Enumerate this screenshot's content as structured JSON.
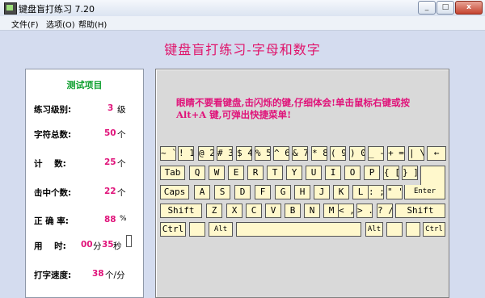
{
  "window": {
    "title": "键盘盲打练习 7.20",
    "minimize_label": "_",
    "maximize_label": "□",
    "close_label": "x"
  },
  "menu": [
    "文件(F)",
    "选项(O)",
    "帮助(H)"
  ],
  "main_title": "键盘盲打练习-字母和数字",
  "stats": {
    "title": "测试项目",
    "level_label": "练习级别:",
    "level_value": "3",
    "level_unit": "级",
    "total_label": "字符总数:",
    "total_value": "50",
    "total_unit": "个",
    "count_label": "计    数:",
    "count_value": "25",
    "count_unit": "个",
    "hit_label": "击中个数:",
    "hit_value": "22",
    "hit_unit": "个",
    "accuracy_label": "正 确 率:",
    "accuracy_value": "88",
    "accuracy_unit": "%",
    "time_label": "用    时:",
    "time_min": "00",
    "time_min_unit": "分",
    "time_sec": "35",
    "time_sec_unit": "秒",
    "speed_label": "打字速度:",
    "speed_value": "38",
    "speed_unit": "个/分"
  },
  "instruction": "眼睛不要看键盘,击闪烁的键,仔细体会!单击鼠标右键或按 Alt+A 键,可弹出快捷菜单!",
  "keyboard": {
    "row1": [
      "~ `",
      "! 1",
      "@ 2",
      "# 3",
      "$ 4",
      "% 5",
      "^ 6",
      "& 7",
      "* 8",
      "( 9",
      ") 0",
      "_ -",
      "+ =",
      "| \\",
      "←"
    ],
    "row2": [
      "Tab",
      "Q",
      "W",
      "E",
      "R",
      "T",
      "Y",
      "U",
      "I",
      "O",
      "P",
      "{ [",
      "} ]"
    ],
    "row3": [
      "Caps",
      "A",
      "S",
      "D",
      "F",
      "G",
      "H",
      "J",
      "K",
      "L",
      ": ;",
      "\" '",
      "Enter"
    ],
    "row4": [
      "Shift",
      "Z",
      "X",
      "C",
      "V",
      "B",
      "N",
      "M",
      "< ,",
      "> .",
      "? /",
      "Shift"
    ],
    "row5": [
      "Ctrl",
      "",
      "Alt",
      "",
      "Alt",
      "",
      "",
      "Ctrl"
    ]
  }
}
